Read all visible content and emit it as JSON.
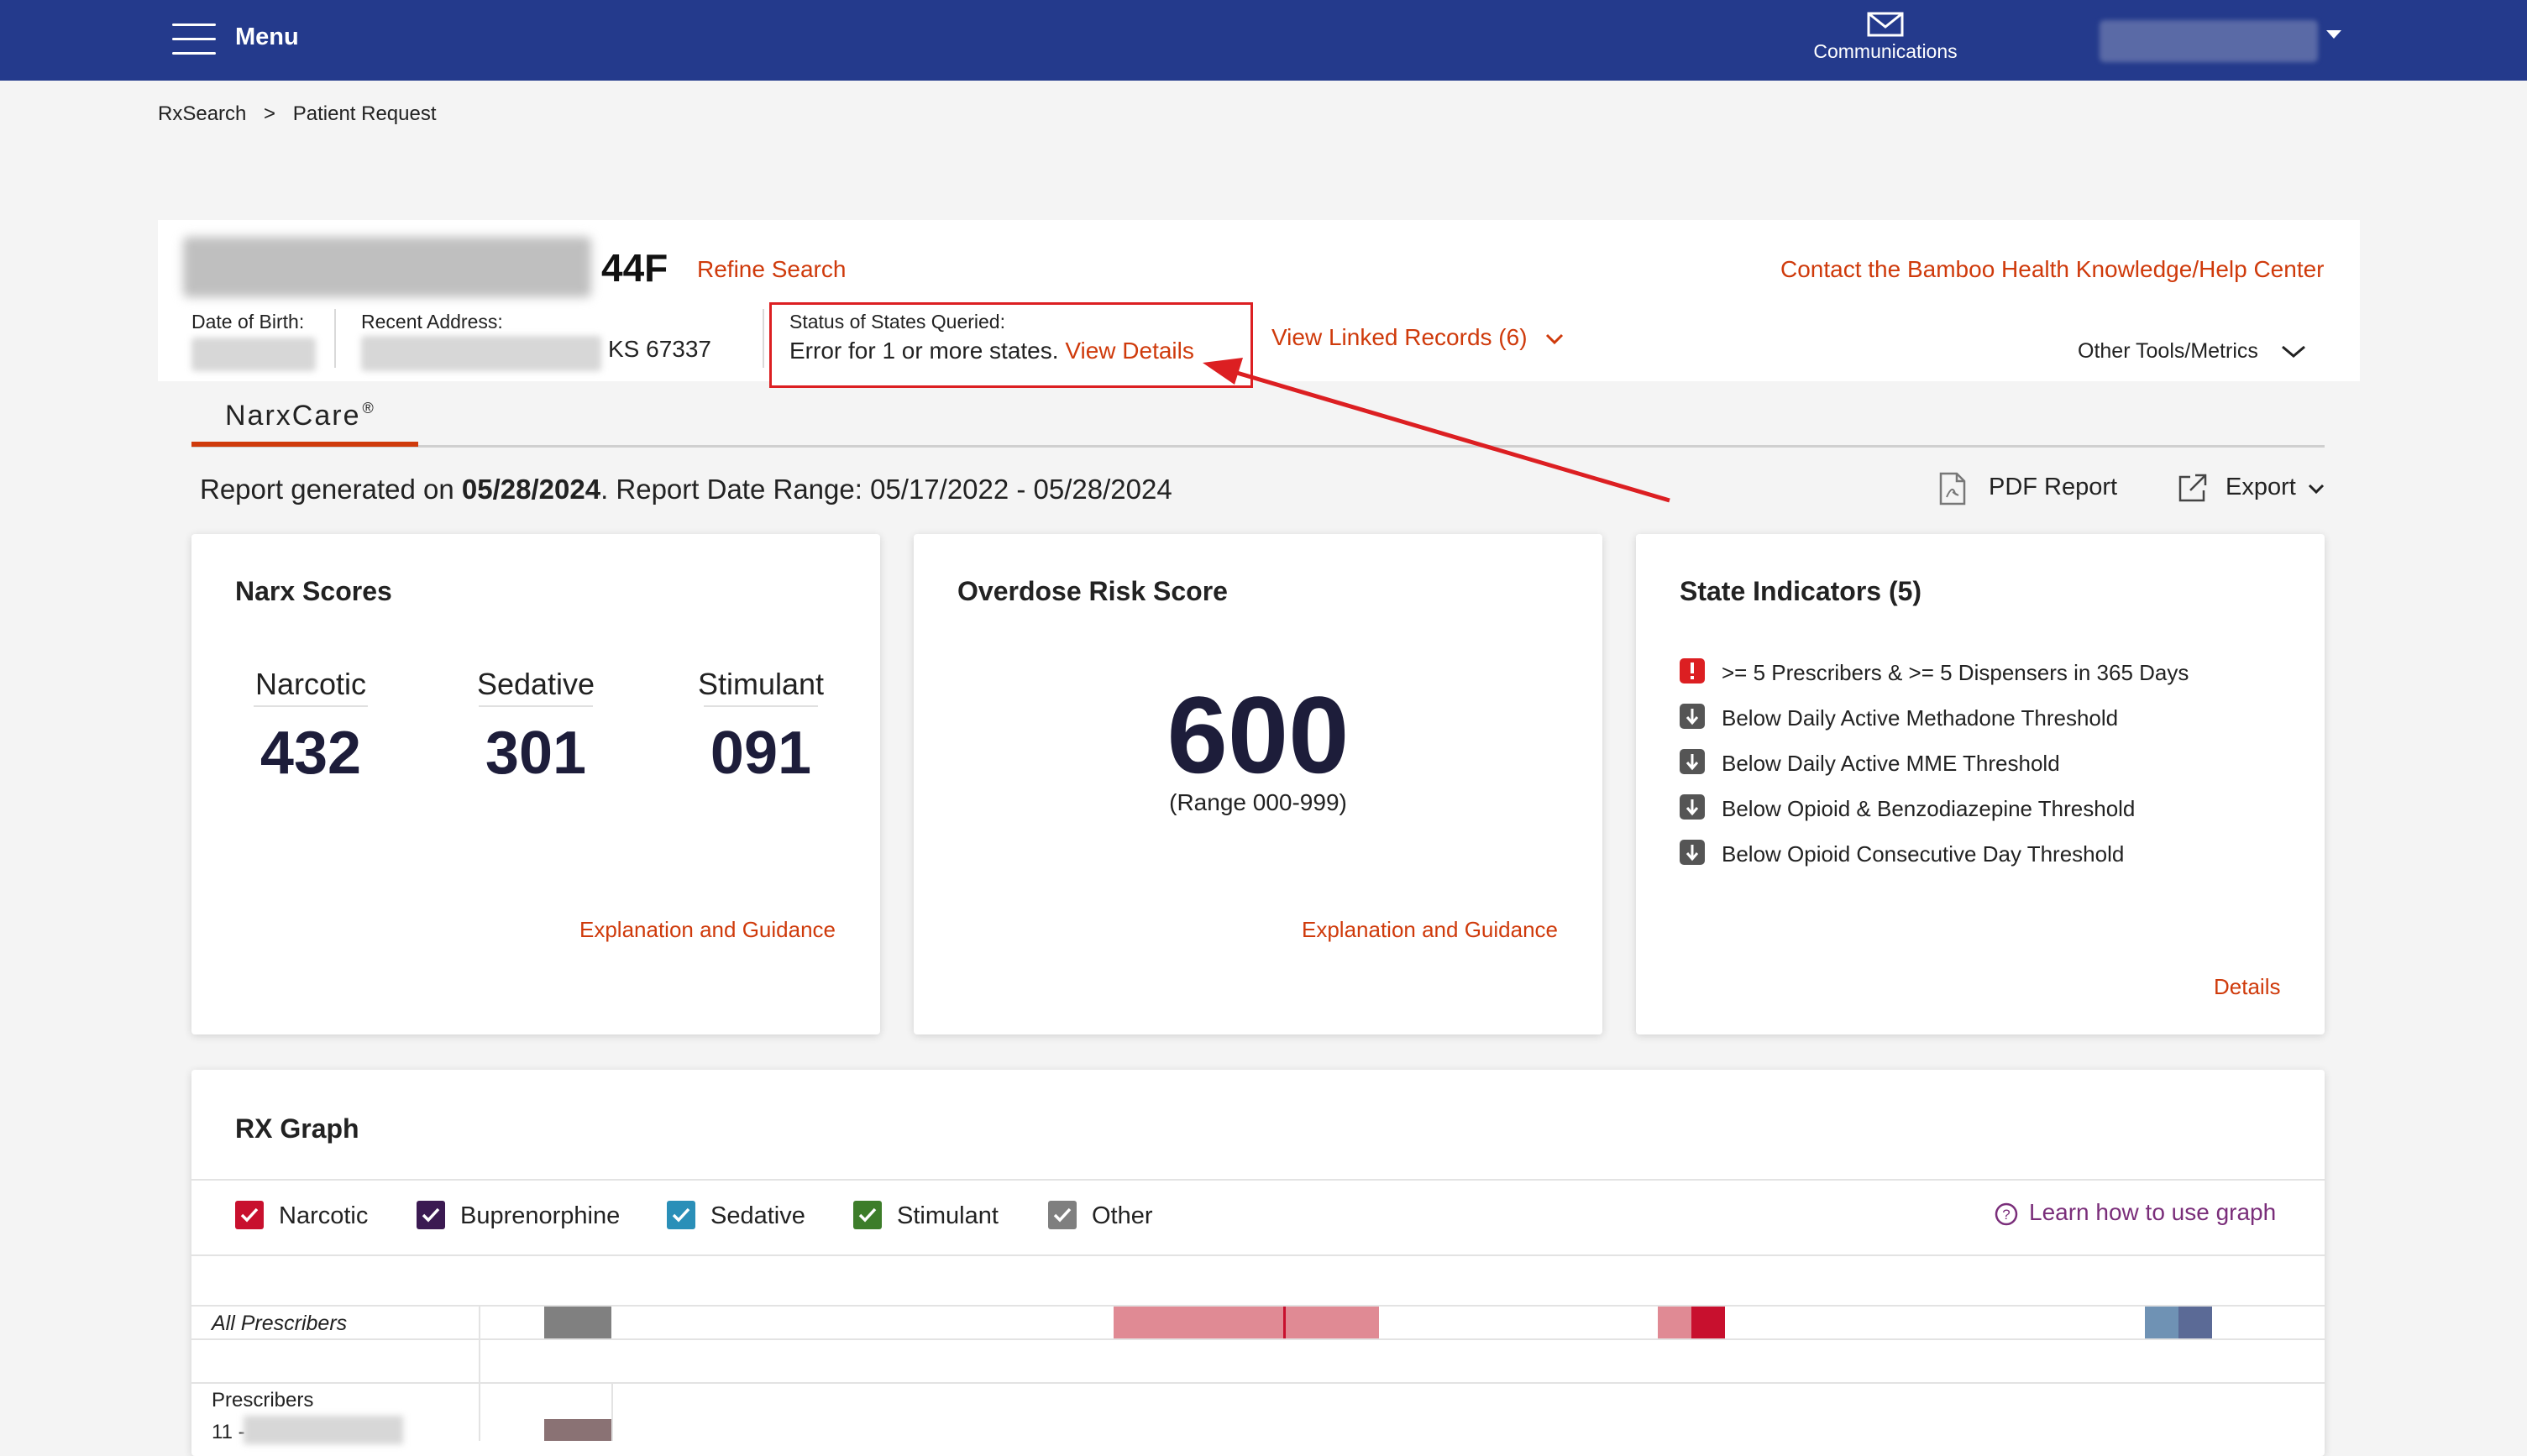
{
  "topbar": {
    "menu_label": "Menu",
    "communications_label": "Communications",
    "bg_color": "#243a8c"
  },
  "breadcrumb": {
    "root": "RxSearch",
    "separator": ">",
    "current": "Patient Request"
  },
  "patient": {
    "age_sex": "44F",
    "refine_search": "Refine Search",
    "contact_link": "Contact the Bamboo Health Knowledge/Help Center",
    "dob_label": "Date of Birth:",
    "address_label": "Recent Address:",
    "address_zip": "KS 67337",
    "status_label": "Status of States Queried:",
    "status_text": "Error for 1 or more states.",
    "status_link": "View Details",
    "linked_records": "View Linked Records (6)",
    "other_tools": "Other Tools/Metrics"
  },
  "tabs": {
    "narxcare": "NarxCare",
    "narxcare_reg": "®"
  },
  "report": {
    "prefix": "Report generated on ",
    "generated_date": "05/28/2024",
    "range_text": ". Report Date Range: 05/17/2022 - 05/28/2024",
    "pdf_label": "PDF Report",
    "export_label": "Export"
  },
  "narx_scores": {
    "title": "Narx Scores",
    "narcotic_label": "Narcotic",
    "narcotic_value": "432",
    "sedative_label": "Sedative",
    "sedative_value": "301",
    "stimulant_label": "Stimulant",
    "stimulant_value": "091",
    "guide_link": "Explanation and Guidance"
  },
  "overdose": {
    "title": "Overdose Risk Score",
    "score": "600",
    "range": "(Range 000-999)",
    "guide_link": "Explanation and Guidance"
  },
  "state_indicators": {
    "title": "State Indicators (5)",
    "items": [
      {
        "text": ">= 5 Prescribers & >= 5 Dispensers in 365 Days",
        "icon": "alert-icon"
      },
      {
        "text": "Below Daily Active Methadone Threshold",
        "icon": "arrow-down-icon"
      },
      {
        "text": "Below Daily Active MME Threshold",
        "icon": "arrow-down-icon"
      },
      {
        "text": "Below Opioid & Benzodiazepine Threshold",
        "icon": "arrow-down-icon"
      },
      {
        "text": "Below Opioid Consecutive Day Threshold",
        "icon": "arrow-down-icon"
      }
    ],
    "details_link": "Details"
  },
  "rx_graph": {
    "title": "RX Graph",
    "legend": [
      {
        "label": "Narcotic",
        "color": "#c8102e"
      },
      {
        "label": "Buprenorphine",
        "color": "#3b1a52"
      },
      {
        "label": "Sedative",
        "color": "#2a8fb8"
      },
      {
        "label": "Stimulant",
        "color": "#3d7d2a"
      },
      {
        "label": "Other",
        "color": "#7f7f7f"
      }
    ],
    "learn_link": "Learn how to use graph",
    "all_prescribers": "All Prescribers",
    "prescribers_header": "Prescribers",
    "row_prefix": "11 -"
  },
  "colors": {
    "link": "#cf3a0b",
    "highlight_box": "#dc1f22"
  }
}
